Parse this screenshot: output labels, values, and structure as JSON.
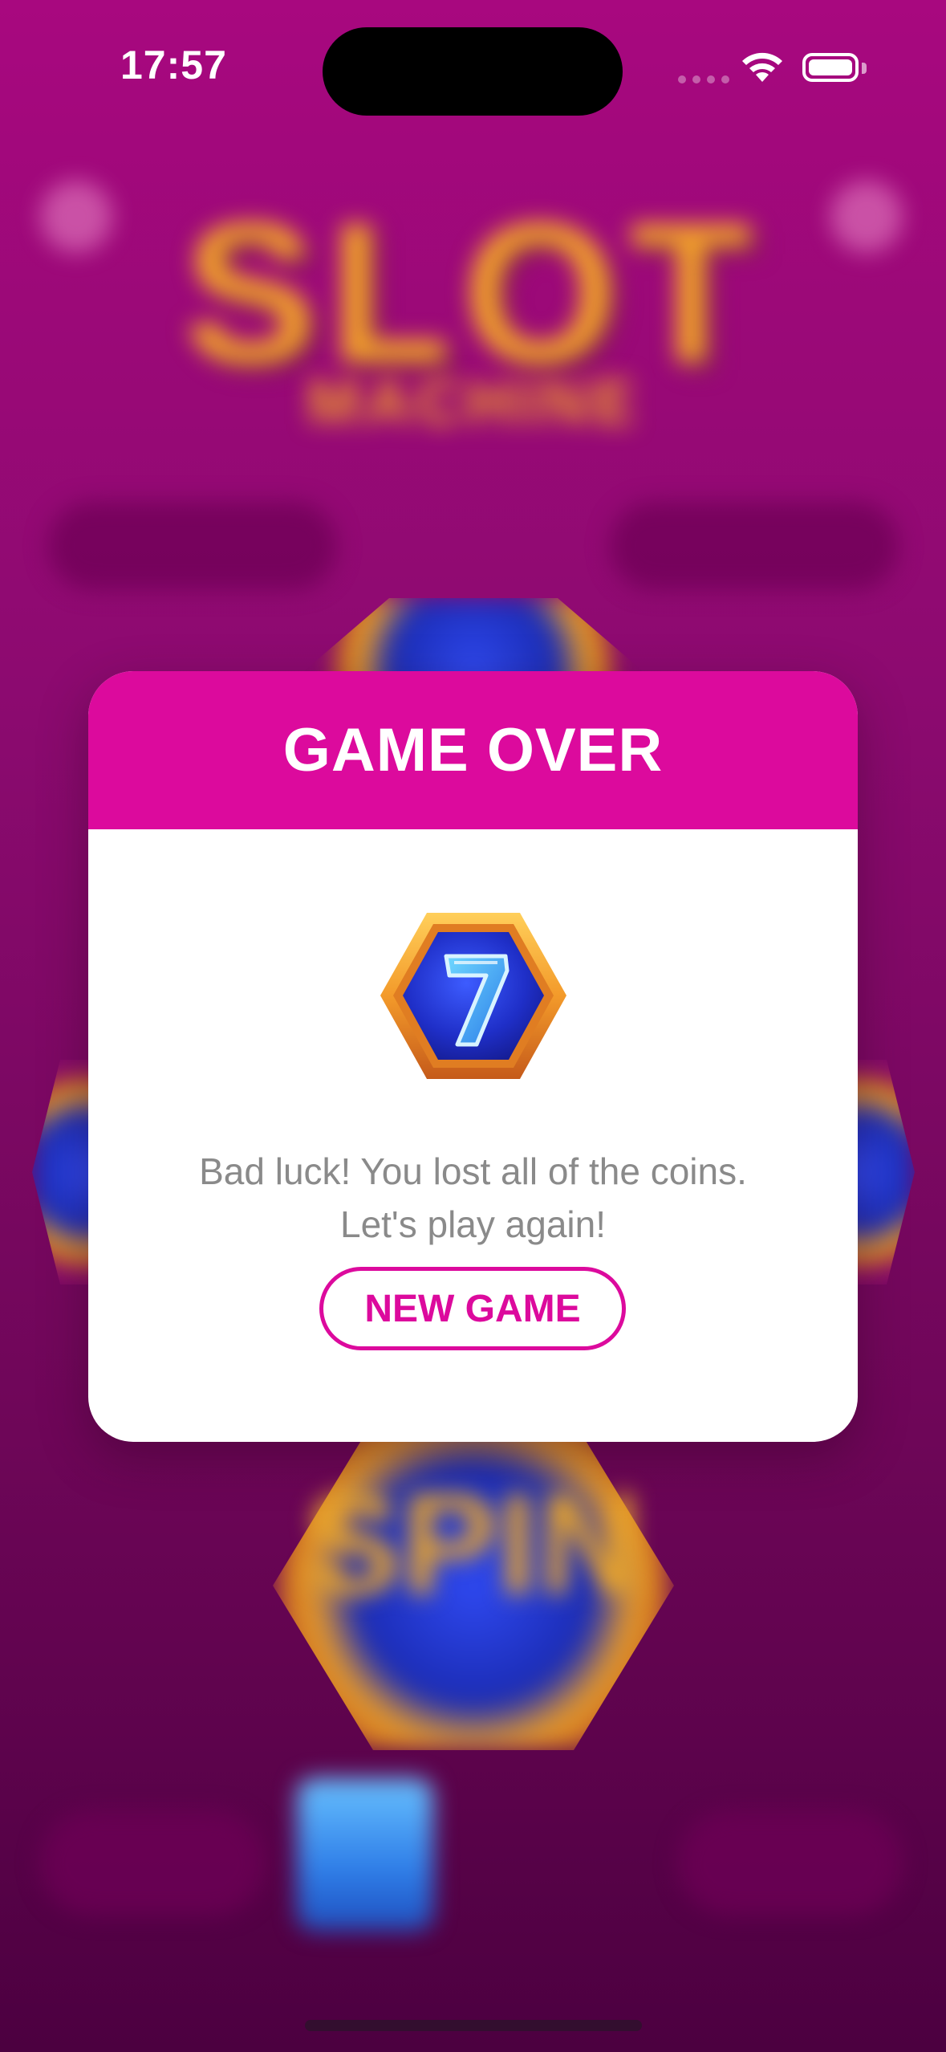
{
  "status_bar": {
    "time": "17:57"
  },
  "background_game": {
    "title": "SLOT",
    "subtitle": "MACHINE",
    "spin_label": "SPIN"
  },
  "modal": {
    "title": "GAME OVER",
    "message_line1": "Bad luck! You lost all of the coins.",
    "message_line2": "Let's play again!",
    "button_label": "NEW GAME"
  },
  "colors": {
    "accent": "#dc0a9d",
    "background_top": "#a8087f",
    "background_bottom": "#4c0040",
    "message_text": "#8a8a8a"
  },
  "icons": {
    "modal_icon": "lucky-seven-icon",
    "wifi": "wifi-icon",
    "battery": "battery-icon"
  }
}
